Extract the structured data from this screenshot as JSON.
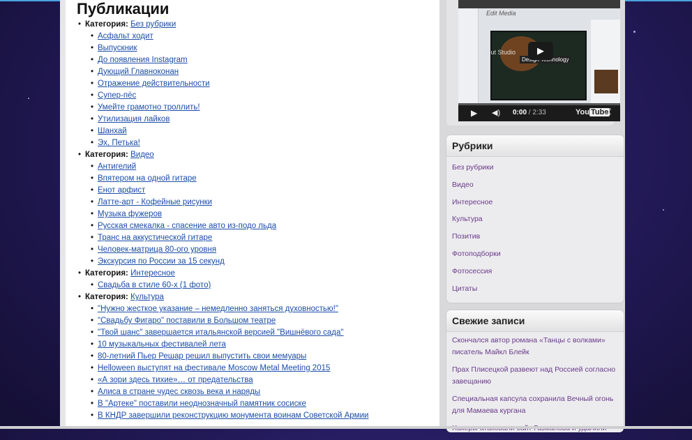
{
  "page_title": "Публикации",
  "category_label": "Категория:",
  "categories": [
    {
      "name": "Без рубрики",
      "posts": [
        "Асфальт ходит",
        "Выпускник",
        "До появления Instagram",
        "Дующий Главноконан",
        "Отражение действительности",
        "Супер-пёс",
        "Умейте грамотно троллить!",
        "Утилизация лайков",
        "Шанхай",
        "Эх, Петька!"
      ]
    },
    {
      "name": "Видео",
      "posts": [
        "Антигелий",
        "Впятером на одной гитаре",
        "Енот арфист",
        "Латте-арт - Кофейные рисунки",
        "Музыка фужеров",
        "Русская смекалка - спасение авто из-подо льда",
        "Транс на аккустической гитаре",
        "Человек-матрица 80-ого уровня",
        "Экскурсия по России за 15 секунд"
      ]
    },
    {
      "name": "Интересное",
      "posts": [
        "Свадьба в стиле 60-х (1 фото)"
      ]
    },
    {
      "name": "Культура",
      "posts": [
        "\"Нужно жесткое указание – немедленно заняться духовностью!\"",
        "\"Свадьбу Фигаро\" поставили в Большом театре",
        "\"Твой шанс\" завершается итальянской версией \"Вишнёвого сада\"",
        "10 музыкальных фестивалей лета",
        "80-летний Пьер Решар решил выпустить свои мемуары",
        "Helloween выступят на фестивале Moscow Metal Meeting 2015",
        "«А зори здесь тихие»… от предательства",
        "Алиса в стране чудес сквозь века и наряды",
        "В \"Артеке\" поставили неоднозначный памятник сосиске",
        "В КНДР завершили реконструкцию монумента воинам Советской Армии"
      ]
    }
  ],
  "video": {
    "screen_title": "Edit Media",
    "thumb_text": "Cut Studio",
    "thumb_caption": "Design Technology",
    "time_current": "0:00",
    "time_total": "/ 2:33",
    "brand_a": "You",
    "brand_b": "Tube",
    "progress": 0
  },
  "rubrics": {
    "title": "Рубрики",
    "items": [
      "Без рубрики",
      "Видео",
      "Интересное",
      "Культура",
      "Позитив",
      "Фотоподборки",
      "Фотосессия",
      "Цитаты"
    ]
  },
  "recent": {
    "title": "Свежие записи",
    "items": [
      "Скончался автор романа «Танцы с волками» писатель Майкл Блейк",
      "Прах Плисецкой развеют над Россией согласно завещанию",
      "Специальная капсула сохранила Вечный огонь для Мамаева кургана",
      "Хакеры атаковали сайт Газманова и удалили"
    ]
  },
  "colors": {
    "link": "#1a4da8",
    "widget_link": "#6a3a8a",
    "background": "#231a5a"
  }
}
